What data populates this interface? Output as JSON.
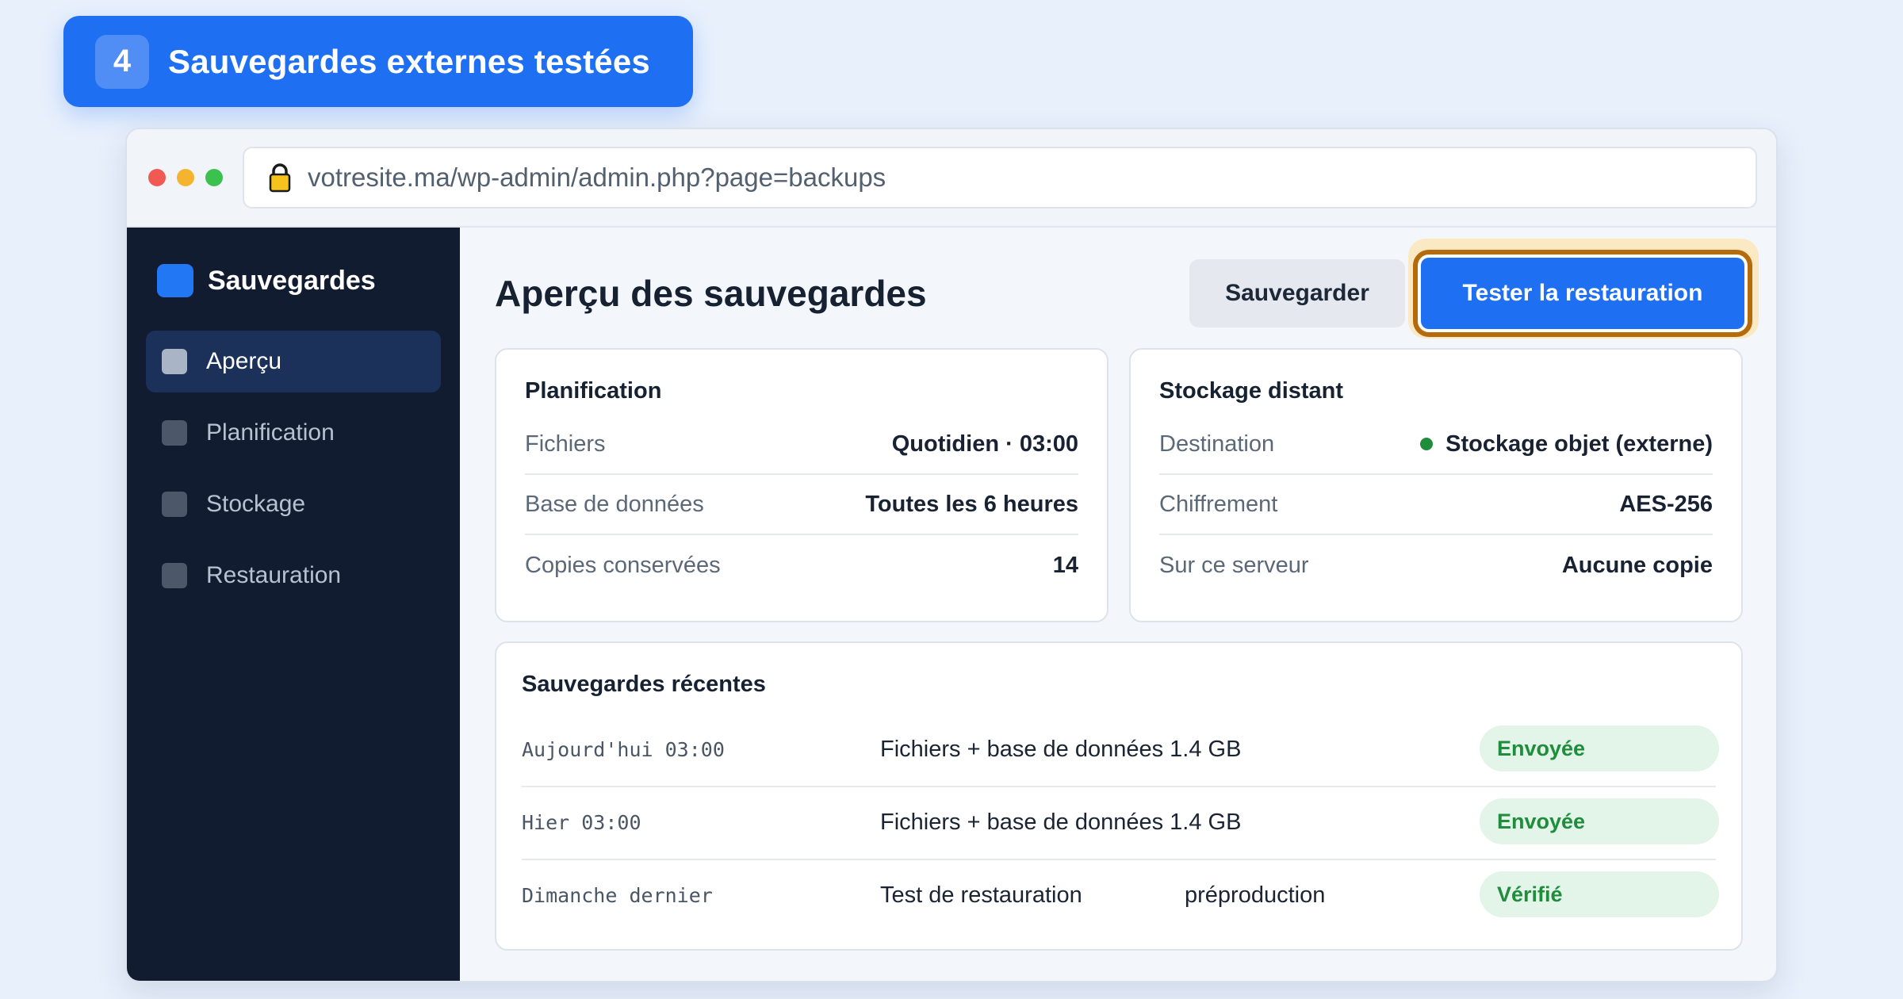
{
  "step": {
    "number": "4",
    "title": "Sauvegardes externes testées"
  },
  "browser": {
    "url": "votresite.ma/wp-admin/admin.php?page=backups"
  },
  "sidebar": {
    "brand": "Sauvegardes",
    "items": [
      {
        "label": "Aperçu",
        "active": true
      },
      {
        "label": "Planification",
        "active": false
      },
      {
        "label": "Stockage",
        "active": false
      },
      {
        "label": "Restauration",
        "active": false
      }
    ]
  },
  "main": {
    "title": "Aperçu des sauvegardes",
    "save_button": "Sauvegarder",
    "restore_button": "Tester la restauration",
    "schedule": {
      "title": "Planification",
      "rows": [
        {
          "key": "Fichiers",
          "value": "Quotidien · 03:00"
        },
        {
          "key": "Base de données",
          "value": "Toutes les 6 heures"
        },
        {
          "key": "Copies conservées",
          "value": "14"
        }
      ]
    },
    "remote": {
      "title": "Stockage distant",
      "rows": [
        {
          "key": "Destination",
          "value": "Stockage objet (externe)",
          "status_color": "#1f8d3b"
        },
        {
          "key": "Chiffrement",
          "value": "AES-256"
        },
        {
          "key": "Sur ce serveur",
          "value": "Aucune copie"
        }
      ]
    },
    "recent": {
      "title": "Sauvegardes récentes",
      "rows": [
        {
          "date": "Aujourd'hui 03:00",
          "description": "Fichiers + base de données 1.4 GB",
          "extra": "",
          "status": "Envoyée"
        },
        {
          "date": "Hier 03:00",
          "description": "Fichiers + base de données 1.4 GB",
          "extra": "",
          "status": "Envoyée"
        },
        {
          "date": "Dimanche dernier",
          "description": "Test de restauration",
          "extra": "préproduction",
          "status": "Vérifié"
        }
      ]
    }
  },
  "colors": {
    "accent": "#1f6ff3",
    "sidebar_bg": "#111c30",
    "focus_ring": "#b56a0c",
    "success": "#1f8d3b"
  }
}
